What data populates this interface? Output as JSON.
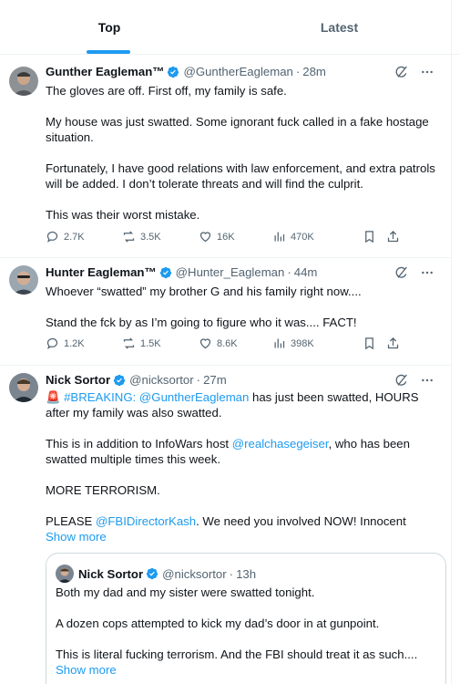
{
  "tabs": [
    {
      "label": "Top",
      "active": true
    },
    {
      "label": "Latest",
      "active": false
    }
  ],
  "colors": {
    "accent": "#1d9bf0",
    "verified": "#1d9bf0",
    "text": "#0f1419",
    "muted": "#536471"
  },
  "tweets": [
    {
      "name": "Gunther Eagleman™",
      "handle": "@GuntherEagleman",
      "time": "28m",
      "lines": [
        "The gloves are off. First off, my family is safe.",
        "",
        "My house was just swatted. Some ignorant fuck called in a fake hostage situation.",
        "",
        "Fortunately, I have good relations with law enforcement, and extra patrols will be added. I don’t tolerate threats and will find the culprit.",
        "",
        "This was their worst mistake."
      ],
      "stats": {
        "replies": "2.7K",
        "reposts": "3.5K",
        "likes": "16K",
        "views": "470K"
      }
    },
    {
      "name": "Hunter Eagleman™",
      "handle": "@Hunter_Eagleman",
      "time": "44m",
      "lines": [
        "Whoever “swatted” my brother G and his family right now....",
        "",
        "Stand the fck by as I’m going to figure who it was.... FACT!"
      ],
      "stats": {
        "replies": "1.2K",
        "reposts": "1.5K",
        "likes": "8.6K",
        "views": "398K"
      }
    },
    {
      "name": "Nick Sortor",
      "handle": "@nicksortor",
      "time": "27m",
      "breaking_emoji": "🚨",
      "breaking_tag": "#BREAKING:",
      "mention1": "@GuntherEagleman",
      "line1_rest": " has just been swatted, HOURS after my family was also swatted.",
      "line2_pre": "This is in addition to InfoWars host ",
      "mention2": "@realchasegeiser",
      "line2_post": ", who has been swatted multiple times this week.",
      "line3": "MORE TERRORISM.",
      "line4_pre": "PLEASE ",
      "mention3": "@FBIDirectorKash",
      "line4_post": ". We need you involved NOW! Innocent",
      "show_more": "Show more",
      "quote": {
        "name": "Nick Sortor",
        "handle": "@nicksortor",
        "time": "13h",
        "lines": [
          "Both my dad and my sister were swatted tonight.",
          "",
          "A dozen cops attempted to kick my dad’s door in at gunpoint.",
          "",
          "This is literal fucking terrorism. And the FBI should treat it as such...."
        ],
        "show_more": "Show more"
      }
    }
  ]
}
